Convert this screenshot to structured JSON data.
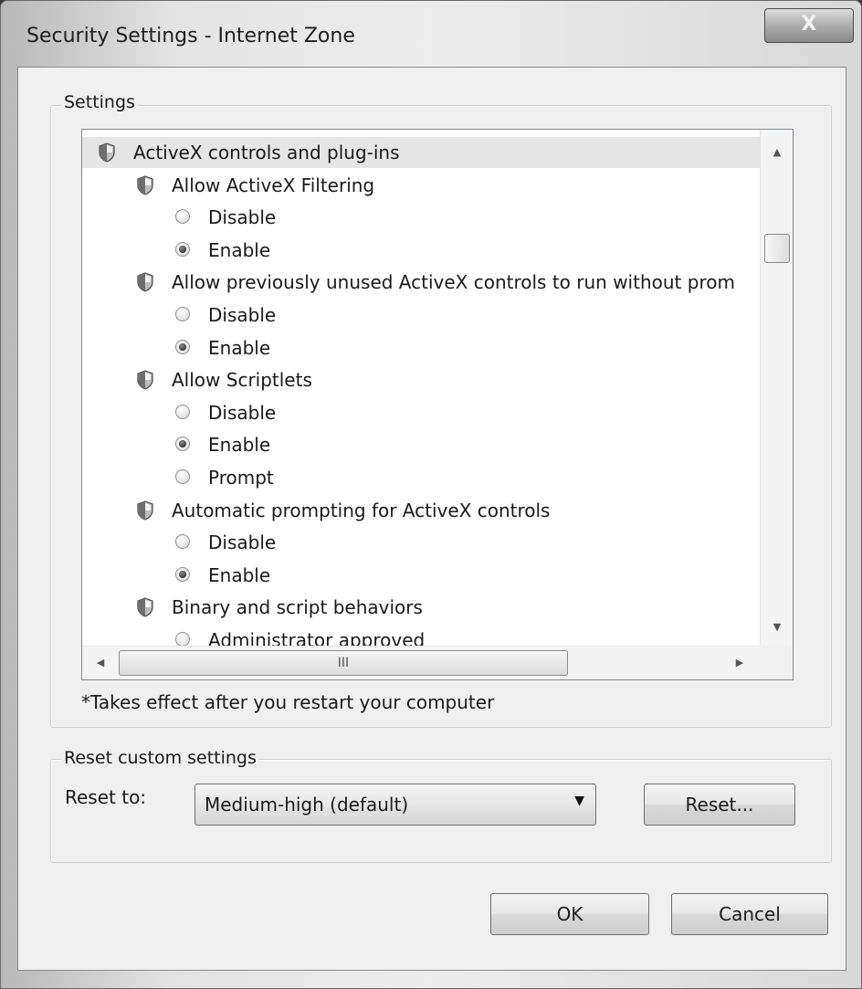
{
  "window": {
    "title": "Security Settings - Internet Zone",
    "close_glyph": "X"
  },
  "settings_group": {
    "label": "Settings",
    "items": [
      {
        "kind": "category",
        "text": "ActiveX controls and plug-ins",
        "icon": "shield-icon"
      },
      {
        "kind": "setting",
        "text": "Allow ActiveX Filtering",
        "icon": "shield-icon"
      },
      {
        "kind": "option",
        "text": "Disable",
        "checked": false
      },
      {
        "kind": "option",
        "text": "Enable",
        "checked": true
      },
      {
        "kind": "setting",
        "text": "Allow previously unused ActiveX controls to run without prom",
        "icon": "shield-icon"
      },
      {
        "kind": "option",
        "text": "Disable",
        "checked": false
      },
      {
        "kind": "option",
        "text": "Enable",
        "checked": true
      },
      {
        "kind": "setting",
        "text": "Allow Scriptlets",
        "icon": "shield-icon"
      },
      {
        "kind": "option",
        "text": "Disable",
        "checked": false
      },
      {
        "kind": "option",
        "text": "Enable",
        "checked": true
      },
      {
        "kind": "option",
        "text": "Prompt",
        "checked": false
      },
      {
        "kind": "setting",
        "text": "Automatic prompting for ActiveX controls",
        "icon": "shield-icon"
      },
      {
        "kind": "option",
        "text": "Disable",
        "checked": false
      },
      {
        "kind": "option",
        "text": "Enable",
        "checked": true
      },
      {
        "kind": "setting",
        "text": "Binary and script behaviors",
        "icon": "shield-icon"
      },
      {
        "kind": "option",
        "text": "Administrator approved",
        "checked": false
      }
    ],
    "scroll": {
      "up_glyph": "▲",
      "down_glyph": "▼",
      "left_glyph": "◀",
      "right_glyph": "▶",
      "grip_glyph": "III"
    },
    "note": "*Takes effect after you restart your computer"
  },
  "reset_group": {
    "label": "Reset custom settings",
    "reset_to_label": "Reset to:",
    "reset_to_value": "Medium-high (default)",
    "dropdown_glyph": "▼",
    "reset_button": "Reset..."
  },
  "buttons": {
    "ok": "OK",
    "cancel": "Cancel"
  },
  "colors": {
    "accent": "#f0f0f0"
  }
}
